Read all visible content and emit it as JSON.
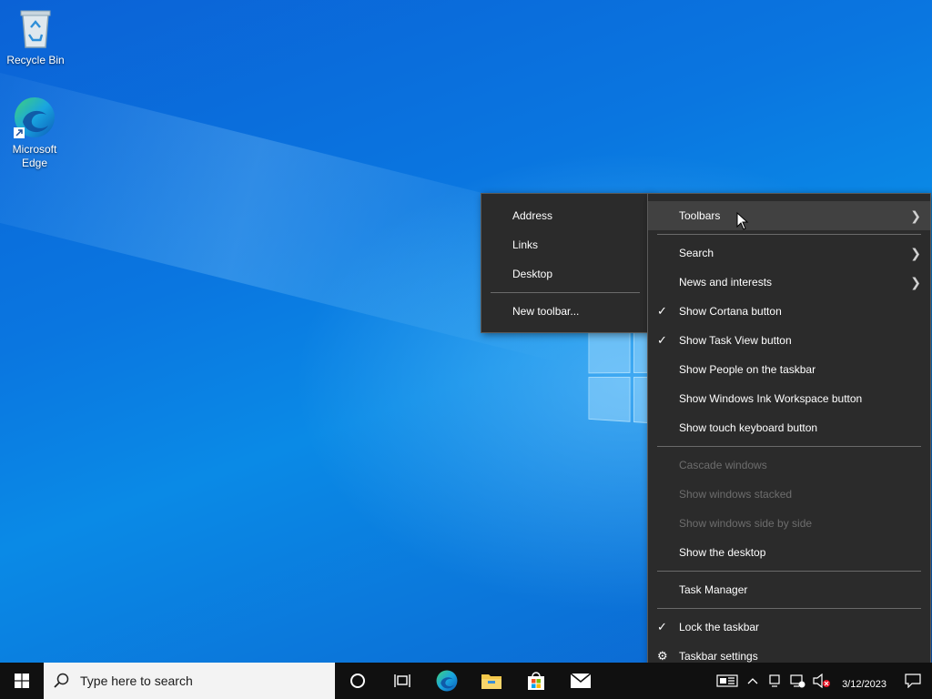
{
  "desktop": {
    "icons": [
      {
        "label": "Recycle Bin",
        "icon": "recycle-bin-icon"
      },
      {
        "label": "Microsoft Edge",
        "icon": "edge-icon"
      }
    ]
  },
  "context_menu": {
    "items": [
      {
        "label": "Toolbars",
        "submenu": true,
        "hover": true
      },
      {
        "label": "Search",
        "submenu": true
      },
      {
        "label": "News and interests",
        "submenu": true
      },
      {
        "label": "Show Cortana button",
        "checked": true
      },
      {
        "label": "Show Task View button",
        "checked": true
      },
      {
        "label": "Show People on the taskbar"
      },
      {
        "label": "Show Windows Ink Workspace button"
      },
      {
        "label": "Show touch keyboard button"
      },
      {
        "label": "Cascade windows",
        "disabled": true
      },
      {
        "label": "Show windows stacked",
        "disabled": true
      },
      {
        "label": "Show windows side by side",
        "disabled": true
      },
      {
        "label": "Show the desktop"
      },
      {
        "label": "Task Manager"
      },
      {
        "label": "Lock the taskbar",
        "checked": true
      },
      {
        "label": "Taskbar settings",
        "icon": "gear-icon"
      }
    ]
  },
  "toolbars_submenu": {
    "items": [
      {
        "label": "Address"
      },
      {
        "label": "Links"
      },
      {
        "label": "Desktop"
      },
      {
        "label": "New toolbar..."
      }
    ]
  },
  "taskbar": {
    "search_placeholder": "Type here to search",
    "pinned": [
      "cortana-icon",
      "task-view-icon",
      "edge-icon",
      "file-explorer-icon",
      "store-icon",
      "mail-icon"
    ],
    "tray_icons": [
      "news-widget-icon",
      "chevron-up-icon",
      "tablet-icon",
      "network-icon",
      "volume-muted-icon",
      "notification-icon"
    ],
    "date": "3/12/2023"
  },
  "colors": {
    "menu_bg": "#2b2b2b",
    "menu_hover": "#414141",
    "taskbar_bg": "#101010",
    "wallpaper_blue": "#0a76e0"
  }
}
